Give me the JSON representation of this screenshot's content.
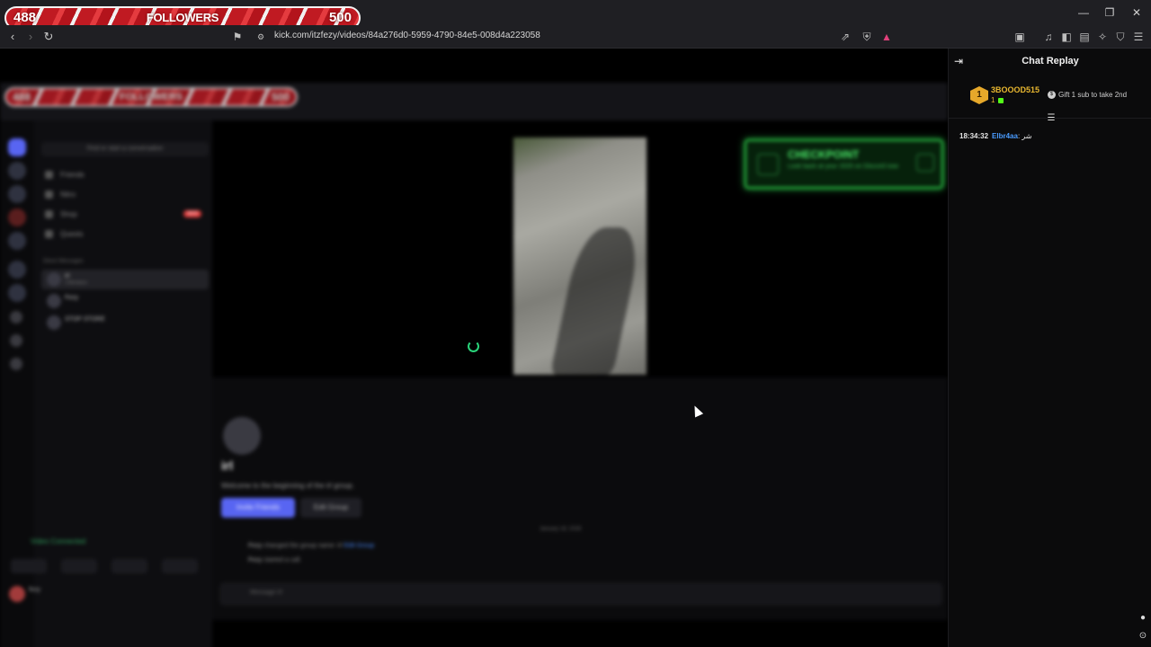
{
  "overlay": {
    "followers_current": "488",
    "followers_label": "FOLLOWERS",
    "followers_goal": "500"
  },
  "browser": {
    "url": "kick.com/itzfezy/videos/84a276d0-5959-4790-84e5-008d4a223058",
    "window_controls": {
      "minimize": "—",
      "restore": "❐",
      "close": "✕"
    }
  },
  "stream": {
    "inner_overlay": {
      "current": "488",
      "label": "FOLLOWERS",
      "goal": "500"
    },
    "discord": {
      "header_title": "Direct Messages",
      "search_placeholder": "Find or start a conversation",
      "nav": [
        "Friends",
        "Nitro",
        "Shop",
        "Quests"
      ],
      "shop_badge": "NEW",
      "dm_header": "Direct Messages",
      "dms": [
        {
          "name": "irl",
          "sub": "3 Members"
        },
        {
          "name": "Fezy",
          "sub": ""
        },
        {
          "name": "STOP STORE",
          "sub": ""
        }
      ],
      "voice_status": "Video Connected",
      "user_name": "fezy",
      "checkpoint_title": "CHECKPOINT",
      "checkpoint_sub": "Look back at your 2025 on Discord now",
      "group_title": "irl",
      "group_welcome": "Welcome to the beginning of the irl group.",
      "invite_label": "Invite Friends",
      "edit_label": "Edit Group",
      "date_divider": "January 18, 2026",
      "sys_line_1_user": "Fezy",
      "sys_line_1": "changed the group name: irl",
      "sys_line_1_link": "Edit Group",
      "sys_line_2_user": "Fezy",
      "sys_line_2": "started a call.",
      "message_placeholder": "Message irl"
    }
  },
  "chat": {
    "title": "Chat Replay",
    "top_gifter": {
      "rank": "1",
      "username": "3BOOOD515",
      "count": "1"
    },
    "gift_prompt": "Gift 1 sub to take 2nd",
    "messages": [
      {
        "time": "18:34:32",
        "user": "Elbr4aa",
        "text": ": شر"
      }
    ]
  }
}
